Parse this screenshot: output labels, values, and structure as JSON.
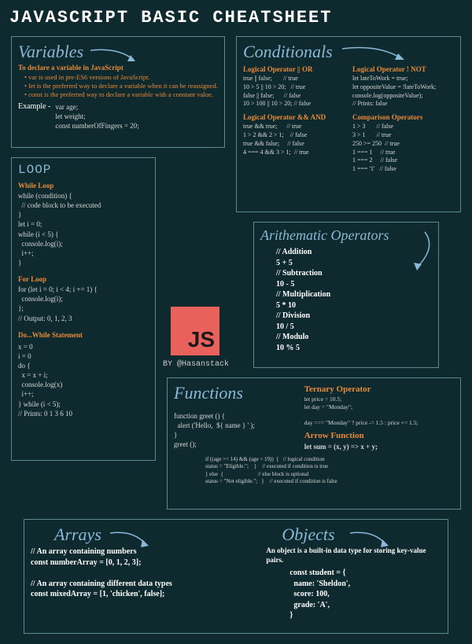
{
  "title": "JAVASCRIPT BASIC CHEATSHEET",
  "byline": "BY @Hasanstack",
  "jsBadge": "JS",
  "variables": {
    "heading": "Variables",
    "intro": "To declare a variable in JavaScript",
    "bullets": [
      "var is used in pre-ES6 versions of JavaScript.",
      "let is the preferred way to declare a variable when it can be reassigned.",
      "const is the preferred way to declare a variable with a constant value."
    ],
    "exampleLabel": "Example -",
    "exampleCode": "var age;\nlet weight;\nconst numberOfFingers = 20;"
  },
  "conditionals": {
    "heading": "Conditionals",
    "orHead": "Logical Operator || OR",
    "orCode": "true || false;       // true\n10 > 5 || 10 > 20;   // true\nfalse || false;      // false\n10 > 100 || 10 > 20; // false",
    "andHead": "Logical Operator && AND",
    "andCode": "true && true;      // true\n1 > 2 && 2 > 1;    // false\ntrue && false;     // false\n4 === 4 && 3 > 1;  // true",
    "notHead": "Logical Operator ! NOT",
    "notCode": "let lateToWork = true;\nlet oppositeValue = !lateToWork;\nconsole.log(oppositeValue);\n// Prints: false",
    "cmpHead": "Comparison Operators",
    "cmpCode": "1 > 3       // false\n3 > 1       // true\n250 >= 250  // true\n1 === 1     // true\n1 === 2     // false\n1 === '1'   // false"
  },
  "loop": {
    "heading": "LOOP",
    "whileHead": "While Loop",
    "whileCode": "while (condition) {\n  // code block to be executed\n}\nlet i = 0;\nwhile (i < 5) {\n  console.log(i);\n  i++;\n}",
    "forHead": "For Loop",
    "forCode": "for (let i = 0; i < 4; i += 1) {\n  console.log(i);\n};\n// Output: 0, 1, 2, 3",
    "doHead": "Do...While Statement",
    "doCode": "x = 0\ni = 0\ndo {\n  x = x + i;\n  console.log(x)\n  i++;\n} while (i < 5);\n// Prints: 0 1 3 6 10"
  },
  "arith": {
    "heading": "Arithematic Operators",
    "code": "// Addition\n5 + 5\n// Subtraction\n10 - 5\n// Multiplication\n5 * 10\n// Division\n10 / 5\n// Modulo\n10 % 5"
  },
  "functions": {
    "heading": "Functions",
    "code": "function greet () {\n  alert ('Hello,  ${ name } ' );\n}\ngreet ();",
    "ternHead": "Ternary Operator",
    "ternCode": "let price = 10.5;\nlet day = \"Monday\";\n\nday === \"Monday\" ? price -= 1.5 : price += 1.5;",
    "arrowHead": "Arrow Function",
    "arrowCode": "let sum = (x, y) => x + y;",
    "ifCode": "if ((age >= 14) && (age < 19))  {   // logical condition\nstatus = \"Eligible.\";    }    // executed if condition is true\n} else  {                         // else block is optional\nstatus = \"Not eligible.\";   }    // executed if condition is false"
  },
  "arrays": {
    "heading": "Arrays",
    "code": "// An array containing numbers\nconst numberArray = [0, 1, 2, 3];\n\n// An array containing different data types\nconst mixedArray = [1, 'chicken', false];"
  },
  "objects": {
    "heading": "Objects",
    "intro": "An object is a built-in data type for storing key-value pairs.",
    "code": "const student = {\n  name: 'Sheldon',\n  score: 100,\n  grade: 'A',\n}"
  }
}
